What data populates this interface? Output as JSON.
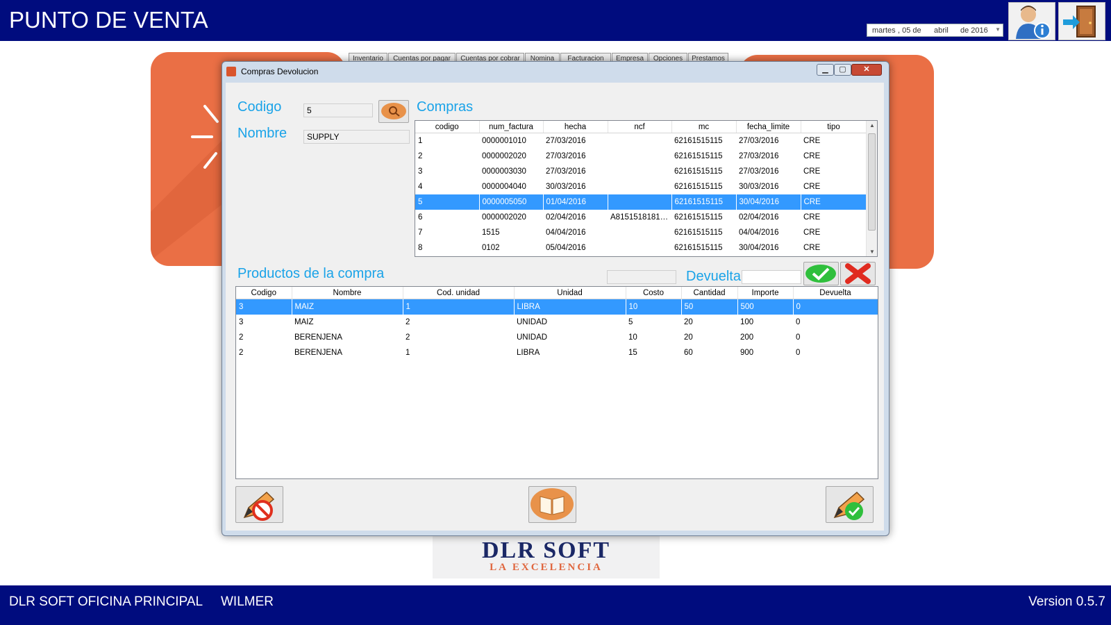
{
  "app": {
    "title": "PUNTO DE VENTA"
  },
  "date_picker": {
    "weekday": "martes",
    "day": ", 05 de",
    "month": "abril",
    "year": "de 2016"
  },
  "toolbar": {
    "user_info_icon": "user-info-icon",
    "exit_icon": "exit-door-icon"
  },
  "background": {
    "tabs": [
      "Inventario",
      "Cuentas por pagar",
      "Cuentas por cobrar",
      "Nomina",
      "Facturacion",
      "Empresa",
      "Opciones",
      "Prestamos"
    ],
    "logo": {
      "main": "DLR SOFT",
      "sub": "LA EXCELENCIA"
    }
  },
  "dialog": {
    "title": "Compras Devolucion",
    "codigo_label": "Codigo",
    "codigo_value": "5",
    "nombre_label": "Nombre",
    "nombre_value": "SUPPLY",
    "compras_label": "Compras",
    "compras_grid": {
      "columns": [
        "codigo",
        "num_factura",
        "hecha",
        "ncf",
        "mc",
        "fecha_limite",
        "tipo"
      ],
      "rows": [
        [
          "1",
          "0000001010",
          "27/03/2016",
          "",
          "62161515115",
          "27/03/2016",
          "CRE"
        ],
        [
          "2",
          "0000002020",
          "27/03/2016",
          "",
          "62161515115",
          "27/03/2016",
          "CRE"
        ],
        [
          "3",
          "0000003030",
          "27/03/2016",
          "",
          "62161515115",
          "27/03/2016",
          "CRE"
        ],
        [
          "4",
          "0000004040",
          "30/03/2016",
          "",
          "62161515115",
          "30/03/2016",
          "CRE"
        ],
        [
          "5",
          "0000005050",
          "01/04/2016",
          "",
          "62161515115",
          "30/04/2016",
          "CRE"
        ],
        [
          "6",
          "0000002020",
          "02/04/2016",
          "A81515181818...",
          "62161515115",
          "02/04/2016",
          "CRE"
        ],
        [
          "7",
          "1515",
          "04/04/2016",
          "",
          "62161515115",
          "04/04/2016",
          "CRE"
        ],
        [
          "8",
          "0102",
          "05/04/2016",
          "",
          "62161515115",
          "30/04/2016",
          "CRE"
        ]
      ],
      "selected_index": 4
    },
    "productos_label": "Productos de la compra",
    "devuelta_label": "Devuelta",
    "productos_grid": {
      "columns": [
        "Codigo",
        "Nombre",
        "Cod. unidad",
        "Unidad",
        "Costo",
        "Cantidad",
        "Importe",
        "Devuelta"
      ],
      "rows": [
        [
          "3",
          "MAIZ",
          "1",
          "LIBRA",
          "10",
          "50",
          "500",
          "0"
        ],
        [
          "3",
          "MAIZ",
          "2",
          "UNIDAD",
          "5",
          "20",
          "100",
          "0"
        ],
        [
          "2",
          "BERENJENA",
          "2",
          "UNIDAD",
          "10",
          "20",
          "200",
          "0"
        ],
        [
          "2",
          "BERENJENA",
          "1",
          "LIBRA",
          "15",
          "60",
          "900",
          "0"
        ]
      ],
      "selected_index": 0
    }
  },
  "status": {
    "office": "DLR SOFT OFICINA PRINCIPAL",
    "user": "WILMER",
    "version": "Version 0.5.7"
  },
  "colors": {
    "bar": "#000c7e",
    "accent": "#1aa3e8",
    "selection": "#3399ff",
    "card": "#ea6f45"
  }
}
